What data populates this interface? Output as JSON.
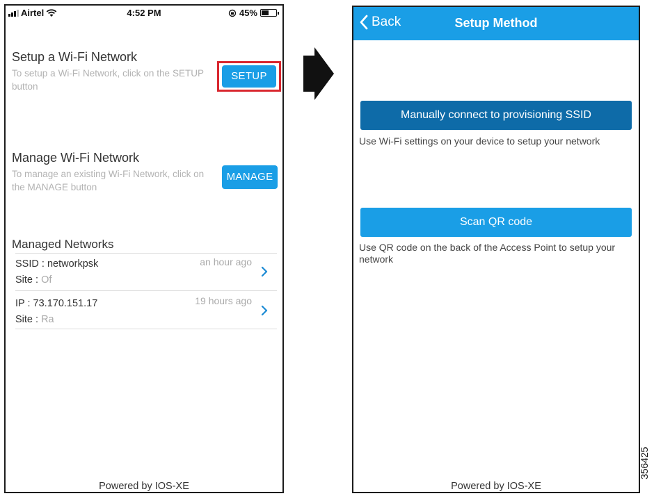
{
  "left_screen": {
    "status_bar": {
      "carrier": "Airtel",
      "time": "4:52 PM",
      "battery": "45%"
    },
    "setup_section": {
      "title": "Setup a Wi-Fi Network",
      "description": "To setup a Wi-Fi Network, click on the SETUP button",
      "button_label": "SETUP"
    },
    "manage_section": {
      "title": "Manage Wi-Fi Network",
      "description": "To manage an existing Wi-Fi Network, click on the MANAGE button",
      "button_label": "MANAGE"
    },
    "managed_networks": {
      "title": "Managed Networks",
      "items": [
        {
          "primary_label": "SSID :",
          "primary_value": "networkpsk",
          "site_label": "Site :",
          "site_value": "Of",
          "time": "an hour ago"
        },
        {
          "primary_label": "IP :",
          "primary_value": "73.170.151.17",
          "site_label": "Site :",
          "site_value": "Ra",
          "time": "19 hours ago"
        }
      ]
    },
    "footer": "Powered by IOS-XE"
  },
  "right_screen": {
    "nav": {
      "back_label": "Back",
      "title": "Setup Method"
    },
    "options": [
      {
        "button_label": "Manually connect to provisioning SSID",
        "description": "Use Wi-Fi settings on your device to setup your network",
        "color": "#0e6ba8"
      },
      {
        "button_label": "Scan QR code",
        "description": "Use QR code on the back of the Access Point to setup your network",
        "color": "#1a9ee6"
      }
    ],
    "footer": "Powered by IOS-XE"
  },
  "figure_id": "356425",
  "colors": {
    "accent": "#1a9ee6",
    "highlight": "#d9262e",
    "chevron": "#1a8ad4"
  },
  "icons": [
    "signal-icon",
    "wifi-icon",
    "rotation-lock-icon",
    "battery-icon",
    "chevron-right-icon",
    "back-chevron-icon",
    "arrow-right-icon"
  ]
}
